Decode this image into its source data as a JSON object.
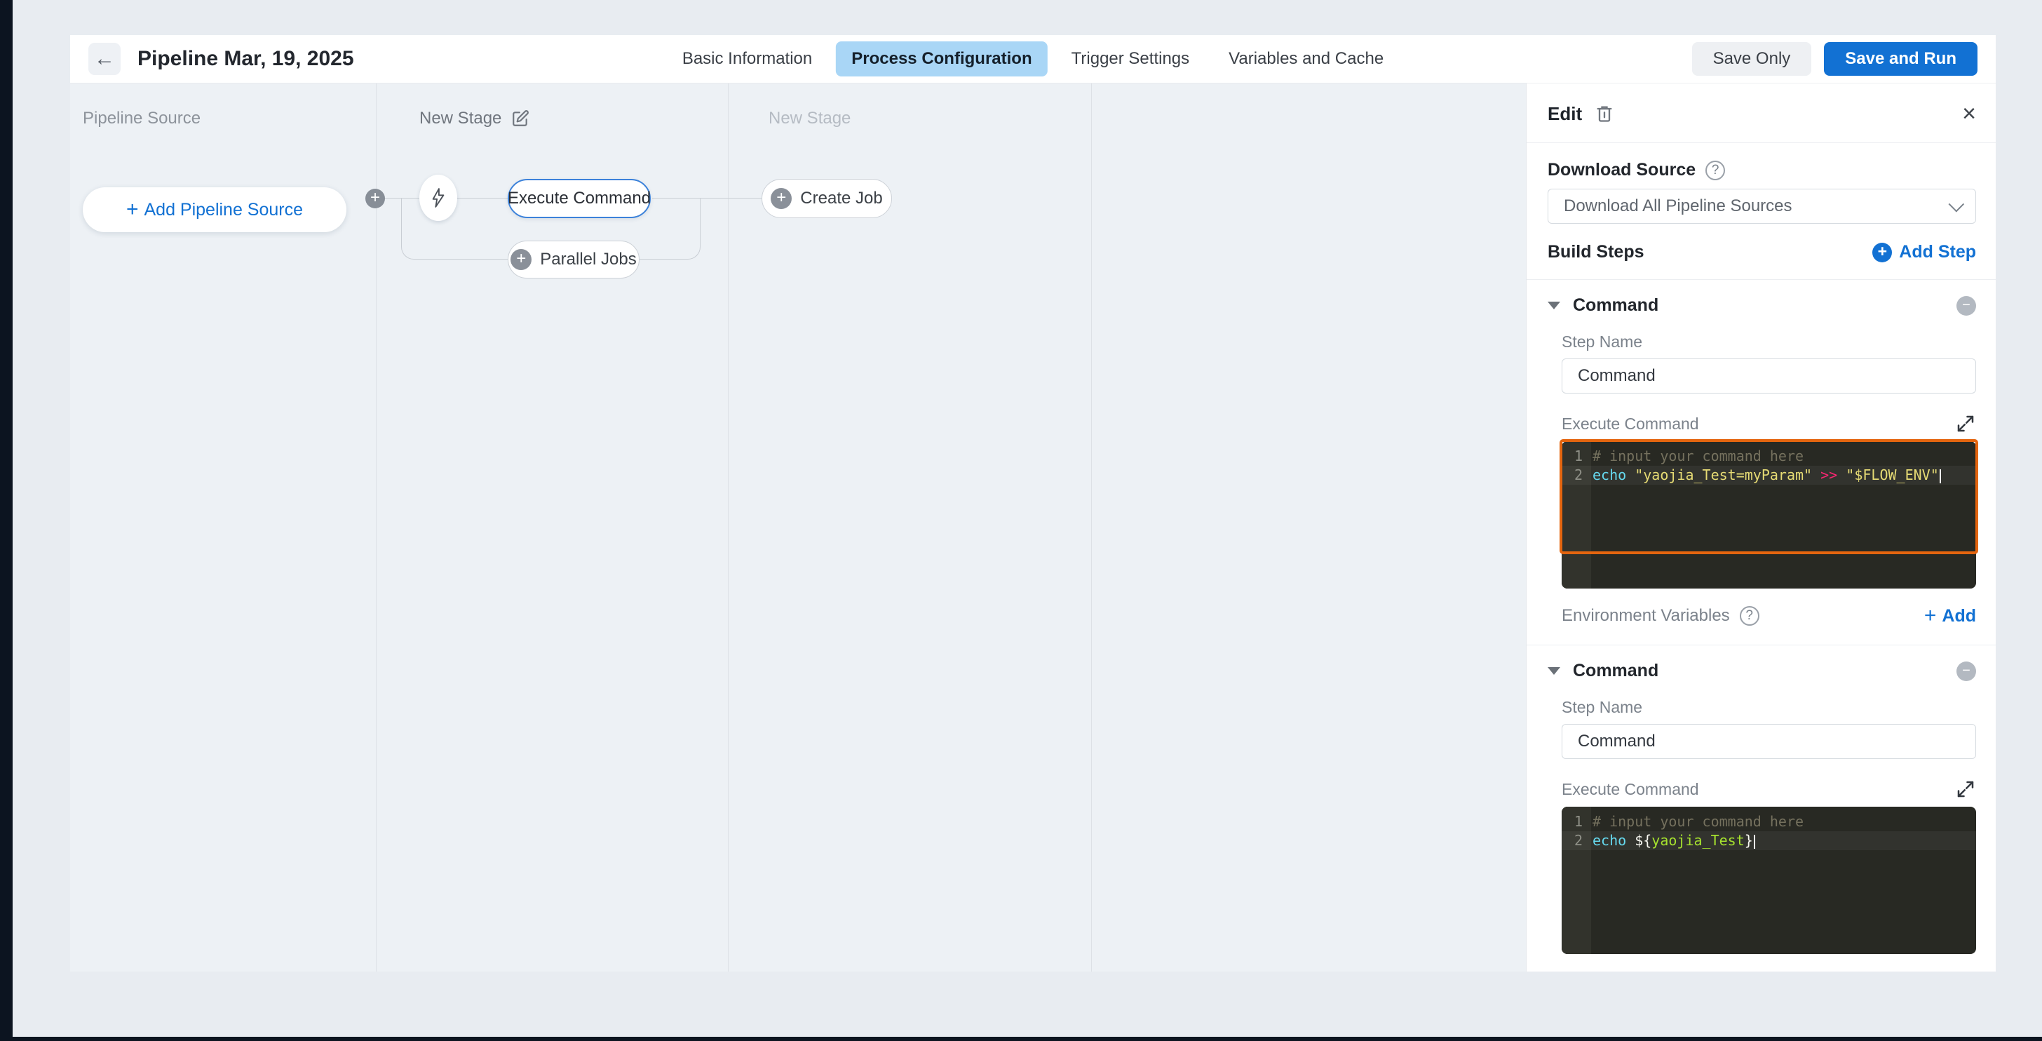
{
  "colors": {
    "accent_blue": "#1271d3",
    "active_tab_bg": "#a9d6f6",
    "focus_orange": "#e4650f",
    "editor_bg": "#282923",
    "node_selected_border": "#3c82da"
  },
  "header": {
    "title": "Pipeline Mar, 19, 2025",
    "tabs": [
      "Basic Information",
      "Process Configuration",
      "Trigger Settings",
      "Variables and Cache"
    ],
    "active_tab": "Process Configuration",
    "save_only_label": "Save Only",
    "save_and_run_label": "Save and Run"
  },
  "canvas": {
    "columns": [
      {
        "label": "Pipeline Source"
      },
      {
        "label": "New Stage"
      },
      {
        "label": "New Stage"
      }
    ],
    "add_pipeline_source_label": "Add Pipeline Source",
    "nodes": {
      "execute_command": "Execute Command",
      "parallel_jobs": "Parallel Jobs",
      "create_job": "Create Job"
    }
  },
  "panel": {
    "title": "Edit",
    "download_source_label": "Download Source",
    "download_source_value": "Download All Pipeline Sources",
    "build_steps_label": "Build Steps",
    "add_step_label": "Add Step",
    "environment_variables_label": "Environment Variables",
    "env_add_label": "Add",
    "steps": [
      {
        "header": "Command",
        "step_name_label": "Step Name",
        "step_name_value": "Command",
        "execute_label": "Execute Command",
        "focused": true,
        "code_lines": [
          {
            "num": "1",
            "tokens": [
              {
                "text": "# input your command here",
                "type": "comment"
              }
            ]
          },
          {
            "num": "2",
            "cursor": true,
            "tokens": [
              {
                "text": "echo",
                "type": "builtin"
              },
              {
                "text": " ",
                "type": "plain"
              },
              {
                "text": "\"yaojia_Test=myParam\"",
                "type": "string"
              },
              {
                "text": " ",
                "type": "plain"
              },
              {
                "text": ">>",
                "type": "operator"
              },
              {
                "text": " ",
                "type": "plain"
              },
              {
                "text": "\"$FLOW_ENV\"",
                "type": "string"
              }
            ]
          }
        ]
      },
      {
        "header": "Command",
        "step_name_label": "Step Name",
        "step_name_value": "Command",
        "execute_label": "Execute Command",
        "focused": false,
        "code_lines": [
          {
            "num": "1",
            "tokens": [
              {
                "text": "# input your command here",
                "type": "comment"
              }
            ]
          },
          {
            "num": "2",
            "cursor": true,
            "tokens": [
              {
                "text": "echo",
                "type": "builtin"
              },
              {
                "text": " ${",
                "type": "plain"
              },
              {
                "text": "yaojia_Test",
                "type": "variable"
              },
              {
                "text": "}",
                "type": "plain"
              }
            ]
          }
        ]
      }
    ]
  }
}
